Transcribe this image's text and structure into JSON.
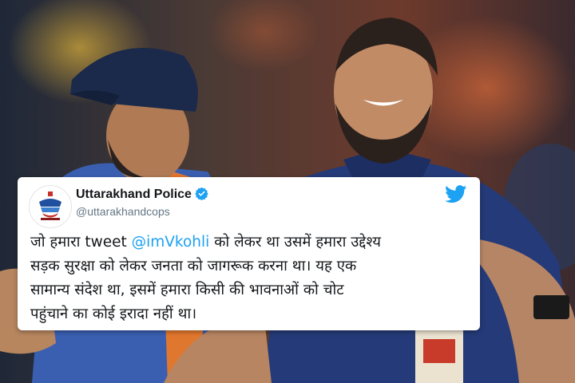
{
  "tweet": {
    "display_name": "Uttarakhand Police",
    "handle": "@uttarakhandcops",
    "verified": true,
    "lines": [
      {
        "before": "जो हमारा tweet ",
        "mention": "@imVkohli",
        "after": " को लेकर था उसमें हमारा उद्देश्य"
      },
      {
        "before": "सड़क सुरक्षा को लेकर जनता को जागरूक करना था। यह एक",
        "mention": "",
        "after": ""
      },
      {
        "before": "सामान्य संदेश था, इसमें हमारा किसी की भावनाओं को चोट",
        "mention": "",
        "after": ""
      },
      {
        "before": "पहुंचाने का कोई इरादा नहीं था।",
        "mention": "",
        "after": ""
      }
    ],
    "colors": {
      "mention": "#1da1f2",
      "twitter_bird": "#1da1f2",
      "verified_badge": "#1da1f2"
    }
  },
  "photo": {
    "description_icons": [
      "player-left-cap",
      "player-right-bearded",
      "stadium-crowd"
    ]
  }
}
